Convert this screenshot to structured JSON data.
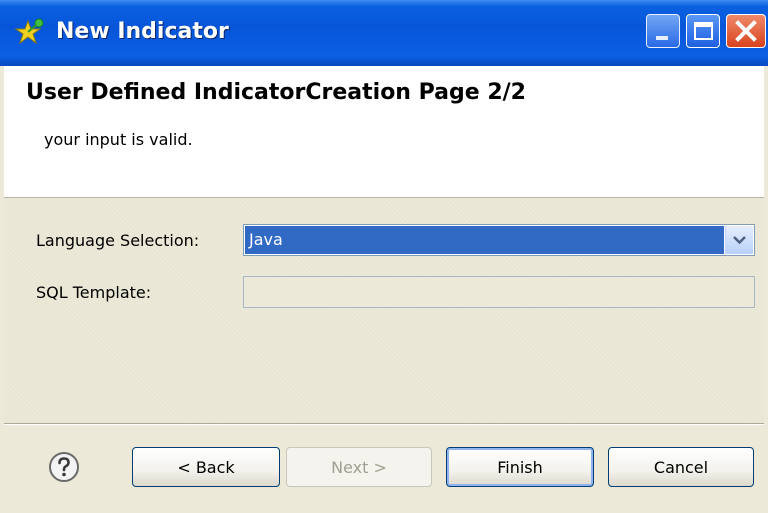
{
  "window": {
    "title": "New Indicator",
    "icon": "new-indicator-star-icon",
    "controls": [
      "minimize-icon",
      "maximize-icon",
      "close-icon"
    ]
  },
  "header": {
    "title": "User Defined IndicatorCreation Page 2/2",
    "message": "your input is valid."
  },
  "form": {
    "language_label": "Language Selection:",
    "language_value": "Java",
    "sql_label": "SQL Template:",
    "sql_value": ""
  },
  "footer": {
    "help_icon": "question-mark-icon",
    "back_label": "< Back",
    "next_label": "Next >",
    "finish_label": "Finish",
    "cancel_label": "Cancel"
  },
  "colors": {
    "titlebar": "#0a61e0",
    "selection": "#316ac5",
    "dialog_bg": "#ece9d8",
    "close_button": "#d8421e"
  }
}
